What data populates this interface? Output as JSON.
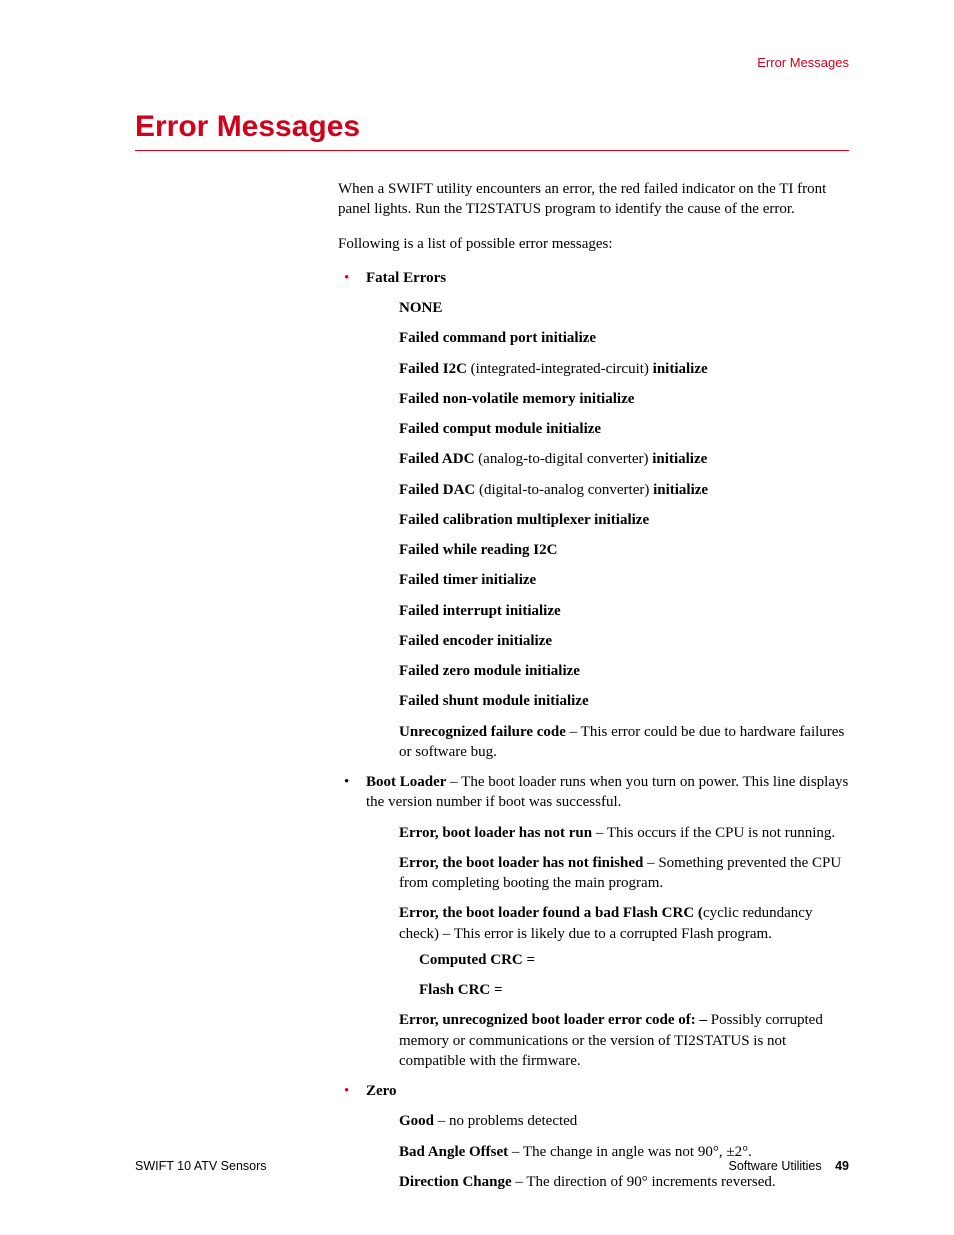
{
  "header": {
    "right": "Error Messages"
  },
  "title": "Error Messages",
  "intro1": "When a SWIFT utility encounters an error, the red failed indicator on the TI front panel lights. Run the TI2STATUS program to identify the cause of the error.",
  "intro2": "Following is a list of possible error messages:",
  "sections": {
    "fatal": {
      "heading": "Fatal Errors",
      "items": {
        "none": "NONE",
        "cmdport": "Failed command port initialize",
        "i2c_b1": "Failed I2C ",
        "i2c_p": "(integrated-integrated-circuit) ",
        "i2c_b2": "initialize",
        "nvm": "Failed non-volatile memory initialize",
        "comput": "Failed comput module initialize",
        "adc_b1": "Failed ADC ",
        "adc_p": "(analog-to-digital converter) ",
        "adc_b2": "initialize",
        "dac_b1": "Failed DAC ",
        "dac_p": "(digital-to-analog converter) ",
        "dac_b2": "initialize",
        "calib": "Failed calibration multiplexer initialize",
        "readi2c": "Failed while reading I2C",
        "timer": "Failed timer initialize",
        "interrupt": "Failed interrupt initialize",
        "encoder": "Failed encoder initialize",
        "zero": "Failed zero module initialize",
        "shunt": "Failed shunt module initialize",
        "unrec_b": "Unrecognized failure code",
        "unrec_t": " – This error could be due to hardware failures or software bug."
      }
    },
    "boot": {
      "heading_b": "Boot Loader",
      "heading_t": " – The boot loader runs when you turn on power. This line displays the version number if boot was successful.",
      "items": {
        "notrun_b": "Error, boot loader has not run",
        "notrun_t": " – This occurs if the CPU is not running.",
        "notfin_b": "Error, the boot loader has not finished",
        "notfin_t": " – Something prevented the CPU from completing booting the main program.",
        "badcrc_b": "Error, the boot loader found a bad Flash CRC (",
        "badcrc_t": "cyclic redundancy check) – This error is likely due to a corrupted Flash program.",
        "comp_crc": "Computed CRC =",
        "flash_crc": "Flash CRC =",
        "unrec_b": "Error, unrecognized boot loader error code of: – ",
        "unrec_t": "Possibly corrupted memory or communications or the version of TI2STATUS is not compatible with the firmware."
      }
    },
    "zero": {
      "heading": "Zero",
      "items": {
        "good_b": "Good",
        "good_t": " – no problems detected",
        "bao_b": "Bad Angle Offset",
        "bao_t": " – The change in angle was not 90°, ±2°.",
        "dir_b": "Direction Change",
        "dir_t": " – The direction of 90° increments reversed."
      }
    }
  },
  "footer": {
    "left": "SWIFT 10 ATV Sensors",
    "right_label": "Software Utilities",
    "page": "49"
  }
}
